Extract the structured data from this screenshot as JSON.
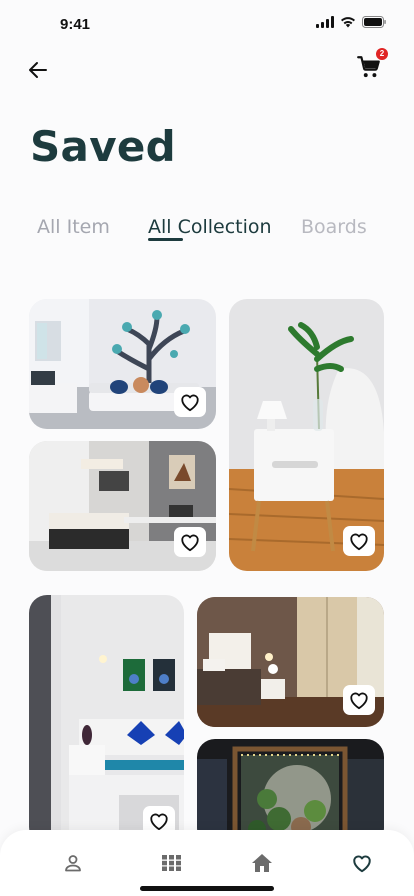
{
  "status_bar": {
    "time": "9:41"
  },
  "header": {
    "cart_count": "2"
  },
  "page_title": "Saved",
  "tabs": [
    {
      "label": "All Item",
      "active": false
    },
    {
      "label": "All Collection",
      "active": true
    },
    {
      "label": "Boards",
      "active": false
    }
  ],
  "cards": [
    {
      "name": "kids-bedroom-tree-mural",
      "saved": false
    },
    {
      "name": "nightstand-with-plant",
      "saved": false
    },
    {
      "name": "bedroom-with-desk",
      "saved": false
    },
    {
      "name": "blue-pillow-bedroom",
      "saved": false
    },
    {
      "name": "warm-bedroom-wardrobe",
      "saved": false
    },
    {
      "name": "plant-display-room",
      "saved": false
    }
  ],
  "bottom_nav": {
    "items": [
      "profile-icon",
      "grid-icon",
      "home-icon",
      "heart-icon"
    ],
    "active": "heart-icon"
  },
  "colors": {
    "primary": "#1d3b3e",
    "inactive": "#a5a7b0",
    "badge": "#e02424"
  }
}
